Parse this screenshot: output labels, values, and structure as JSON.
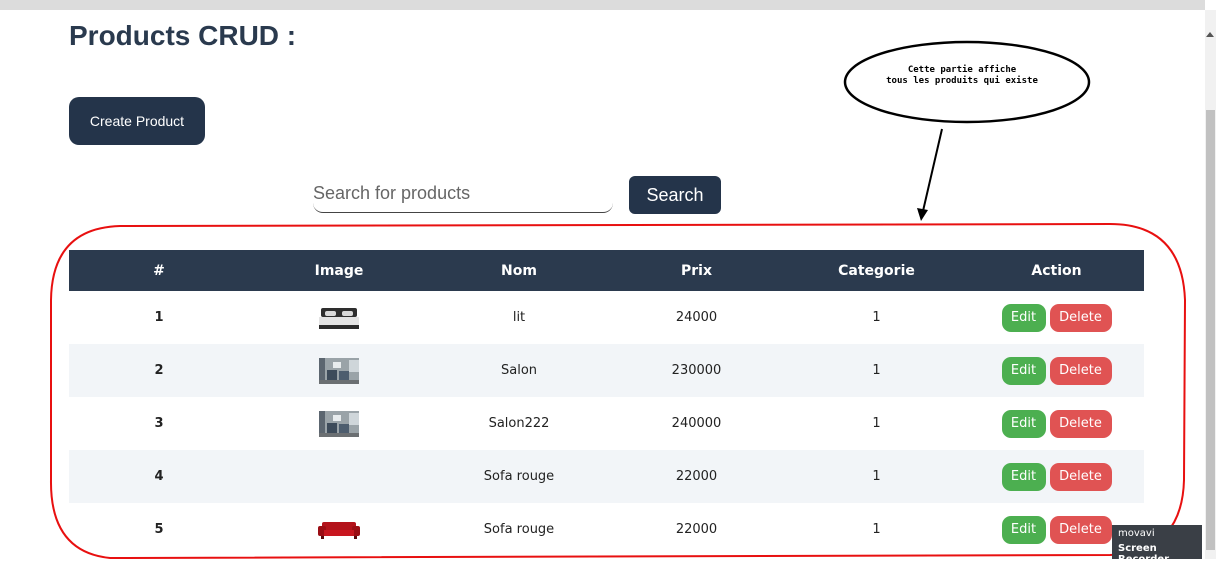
{
  "page": {
    "title": "Products CRUD :"
  },
  "toolbar": {
    "create_label": "Create Product"
  },
  "search": {
    "placeholder": "Search for products",
    "button_label": "Search"
  },
  "table": {
    "headers": [
      "#",
      "Image",
      "Nom",
      "Prix",
      "Categorie",
      "Action"
    ],
    "rows": [
      {
        "idx": "1",
        "image": "bed",
        "nom": "lit",
        "prix": "24000",
        "categorie": "1"
      },
      {
        "idx": "2",
        "image": "living-room",
        "nom": "Salon",
        "prix": "230000",
        "categorie": "1"
      },
      {
        "idx": "3",
        "image": "living-room",
        "nom": "Salon222",
        "prix": "240000",
        "categorie": "1"
      },
      {
        "idx": "4",
        "image": "",
        "nom": "Sofa rouge",
        "prix": "22000",
        "categorie": "1"
      },
      {
        "idx": "5",
        "image": "red-sofa",
        "nom": "Sofa rouge",
        "prix": "22000",
        "categorie": "1"
      }
    ],
    "edit_label": "Edit",
    "delete_label": "Delete"
  },
  "annotation": {
    "line1": "Cette partie affiche",
    "line2": "tous les produits qui existe",
    "highlight_color": "#e81010"
  },
  "watermark": {
    "brand": "movavi",
    "product": "Screen Recorder"
  },
  "colors": {
    "primary": "#24344a",
    "edit": "#4caf50",
    "delete": "#e05353"
  }
}
